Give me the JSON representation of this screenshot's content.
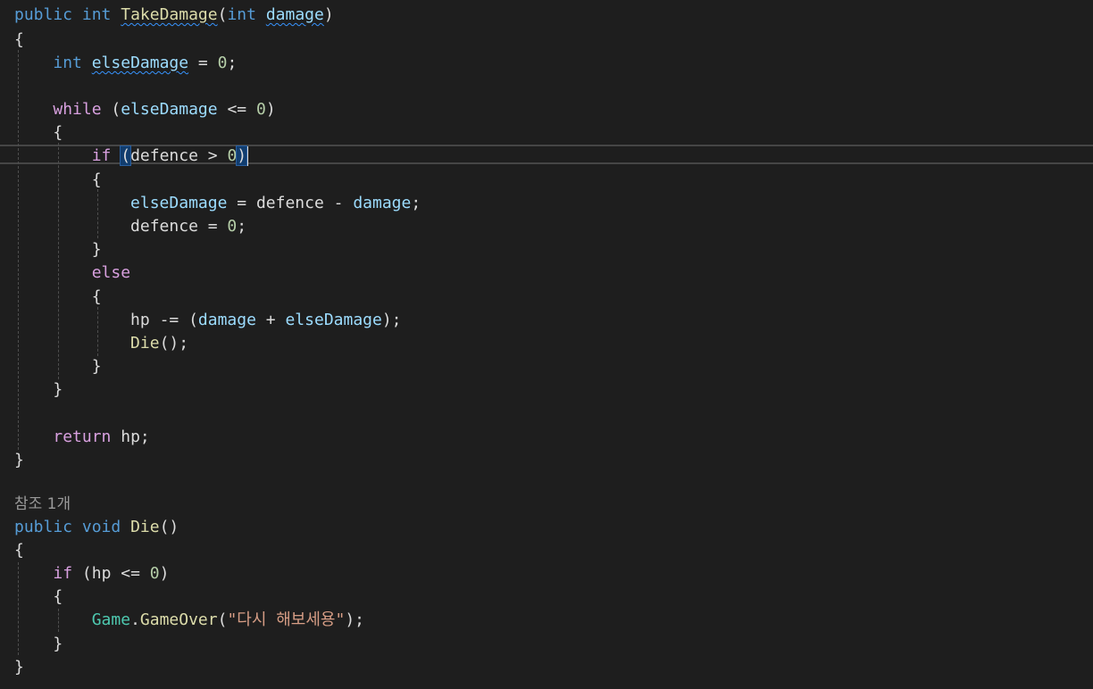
{
  "editor": {
    "codelens_references": "참조 1개",
    "tokens": {
      "public": "public",
      "int": "int",
      "void": "void",
      "while": "while",
      "if": "if",
      "else": "else",
      "return": "return",
      "TakeDamage": "TakeDamage",
      "damage": "damage",
      "elseDamage": "elseDamage",
      "defence": "defence",
      "hp": "hp",
      "Die": "Die",
      "Game": "Game",
      "GameOver": "GameOver",
      "zero": "0",
      "string_literal": "\"다시 해보세용\""
    }
  }
}
